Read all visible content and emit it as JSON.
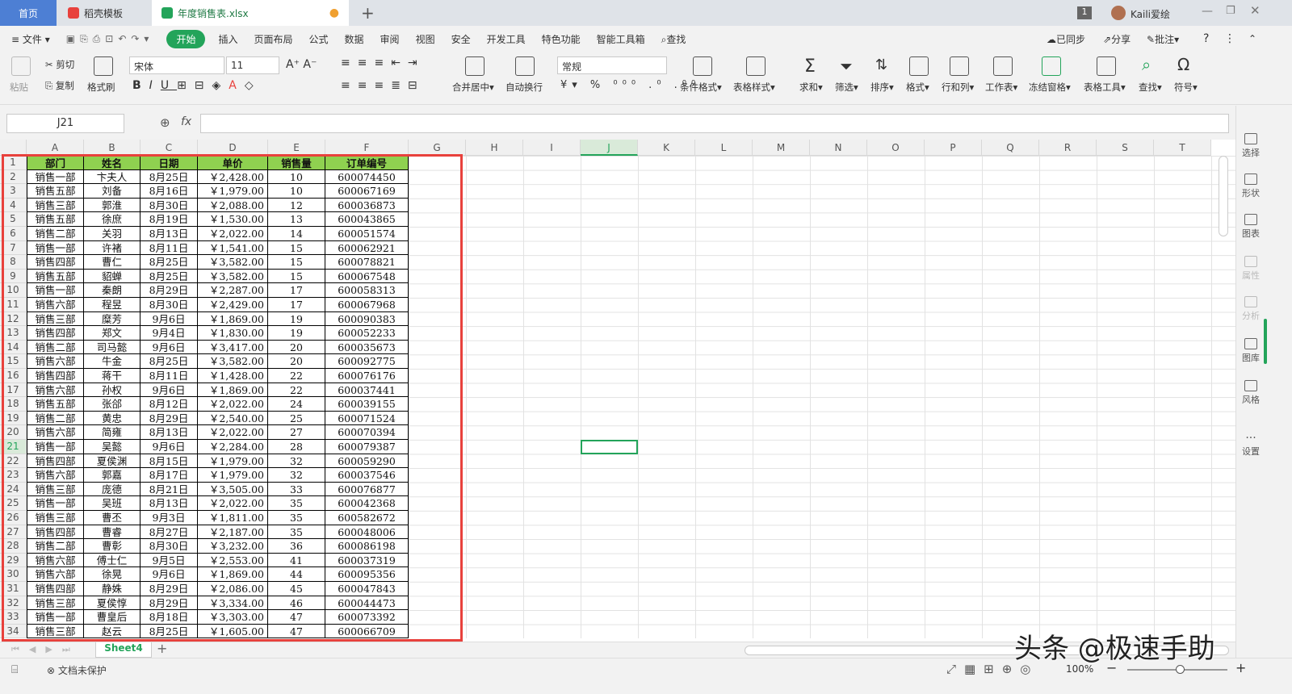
{
  "titlebar": {
    "tabs": [
      "首页",
      "稻壳模板",
      "年度销售表.xlsx"
    ],
    "user": "Kaili爱绘",
    "badge": "1"
  },
  "menubar": {
    "file": "文件",
    "items": [
      "开始",
      "插入",
      "页面布局",
      "公式",
      "数据",
      "审阅",
      "视图",
      "安全",
      "开发工具",
      "特色功能",
      "智能工具箱"
    ],
    "search": "查找",
    "right": [
      "已同步",
      "分享",
      "批注"
    ]
  },
  "ribbon": {
    "paste": "粘贴",
    "cut": "剪切",
    "copy": "复制",
    "format_painter": "格式刷",
    "font_name": "宋体",
    "font_size": "11",
    "merge": "合并居中",
    "wrap": "自动换行",
    "number_format": "常规",
    "conditional": "条件格式",
    "table_style": "表格样式",
    "sum": "求和",
    "filter": "筛选",
    "sort": "排序",
    "format": "格式",
    "rowcol": "行和列",
    "worksheet": "工作表",
    "freeze": "冻结窗格",
    "table_tools": "表格工具",
    "find": "查找",
    "symbol": "符号"
  },
  "formula": {
    "cell_ref": "J21",
    "fx": "fx"
  },
  "columns": [
    "A",
    "B",
    "C",
    "D",
    "E",
    "F",
    "G",
    "H",
    "I",
    "J",
    "K",
    "L",
    "M",
    "N",
    "O",
    "P",
    "Q",
    "R",
    "S",
    "T"
  ],
  "table": {
    "headers": [
      "部门",
      "姓名",
      "日期",
      "单价",
      "销售量",
      "订单编号"
    ],
    "rows": [
      [
        "销售一部",
        "卞夫人",
        "8月25日",
        "￥2,428.00",
        "10",
        "600074450"
      ],
      [
        "销售五部",
        "刘备",
        "8月16日",
        "￥1,979.00",
        "10",
        "600067169"
      ],
      [
        "销售三部",
        "郭淮",
        "8月30日",
        "￥2,088.00",
        "12",
        "600036873"
      ],
      [
        "销售五部",
        "徐庶",
        "8月19日",
        "￥1,530.00",
        "13",
        "600043865"
      ],
      [
        "销售二部",
        "关羽",
        "8月13日",
        "￥2,022.00",
        "14",
        "600051574"
      ],
      [
        "销售一部",
        "许褚",
        "8月11日",
        "￥1,541.00",
        "15",
        "600062921"
      ],
      [
        "销售四部",
        "曹仁",
        "8月25日",
        "￥3,582.00",
        "15",
        "600078821"
      ],
      [
        "销售五部",
        "貂蝉",
        "8月25日",
        "￥3,582.00",
        "15",
        "600067548"
      ],
      [
        "销售一部",
        "秦朗",
        "8月29日",
        "￥2,287.00",
        "17",
        "600058313"
      ],
      [
        "销售六部",
        "程昱",
        "8月30日",
        "￥2,429.00",
        "17",
        "600067968"
      ],
      [
        "销售三部",
        "糜芳",
        "9月6日",
        "￥1,869.00",
        "19",
        "600090383"
      ],
      [
        "销售四部",
        "郑文",
        "9月4日",
        "￥1,830.00",
        "19",
        "600052233"
      ],
      [
        "销售二部",
        "司马懿",
        "9月6日",
        "￥3,417.00",
        "20",
        "600035673"
      ],
      [
        "销售六部",
        "牛金",
        "8月25日",
        "￥3,582.00",
        "20",
        "600092775"
      ],
      [
        "销售四部",
        "蒋干",
        "8月11日",
        "￥1,428.00",
        "22",
        "600076176"
      ],
      [
        "销售六部",
        "孙权",
        "9月6日",
        "￥1,869.00",
        "22",
        "600037441"
      ],
      [
        "销售五部",
        "张郃",
        "8月12日",
        "￥2,022.00",
        "24",
        "600039155"
      ],
      [
        "销售二部",
        "黄忠",
        "8月29日",
        "￥2,540.00",
        "25",
        "600071524"
      ],
      [
        "销售六部",
        "简雍",
        "8月13日",
        "￥2,022.00",
        "27",
        "600070394"
      ],
      [
        "销售一部",
        "吴懿",
        "9月6日",
        "￥2,284.00",
        "28",
        "600079387"
      ],
      [
        "销售四部",
        "夏侯渊",
        "8月15日",
        "￥1,979.00",
        "32",
        "600059290"
      ],
      [
        "销售六部",
        "郭嘉",
        "8月17日",
        "￥1,979.00",
        "32",
        "600037546"
      ],
      [
        "销售三部",
        "庞德",
        "8月21日",
        "￥3,505.00",
        "33",
        "600076877"
      ],
      [
        "销售一部",
        "吴班",
        "8月13日",
        "￥2,022.00",
        "35",
        "600042368"
      ],
      [
        "销售三部",
        "曹丕",
        "9月3日",
        "￥1,811.00",
        "35",
        "600582672"
      ],
      [
        "销售四部",
        "曹睿",
        "8月27日",
        "￥2,187.00",
        "35",
        "600048006"
      ],
      [
        "销售二部",
        "曹彰",
        "8月30日",
        "￥3,232.00",
        "36",
        "600086198"
      ],
      [
        "销售六部",
        "傅士仁",
        "9月5日",
        "￥2,553.00",
        "41",
        "600037319"
      ],
      [
        "销售六部",
        "徐晃",
        "9月6日",
        "￥1,869.00",
        "44",
        "600095356"
      ],
      [
        "销售四部",
        "静姝",
        "8月29日",
        "￥2,086.00",
        "45",
        "600047843"
      ],
      [
        "销售三部",
        "夏侯惇",
        "8月29日",
        "￥3,334.00",
        "46",
        "600044473"
      ],
      [
        "销售一部",
        "曹皇后",
        "8月18日",
        "￥3,303.00",
        "47",
        "600073392"
      ],
      [
        "销售三部",
        "赵云",
        "8月25日",
        "￥1,605.00",
        "47",
        "600066709"
      ]
    ]
  },
  "sheet": {
    "name": "Sheet4"
  },
  "status": {
    "protect": "文档未保护",
    "zoom": "100%"
  },
  "sidepanel": [
    "选择",
    "形状",
    "图表",
    "属性",
    "分析",
    "图库",
    "风格",
    "设置"
  ],
  "watermark": "头条 @极速手助",
  "colors": {
    "accent": "#23a45a",
    "header_fill": "#8fd150",
    "highlight": "#e8413c"
  }
}
